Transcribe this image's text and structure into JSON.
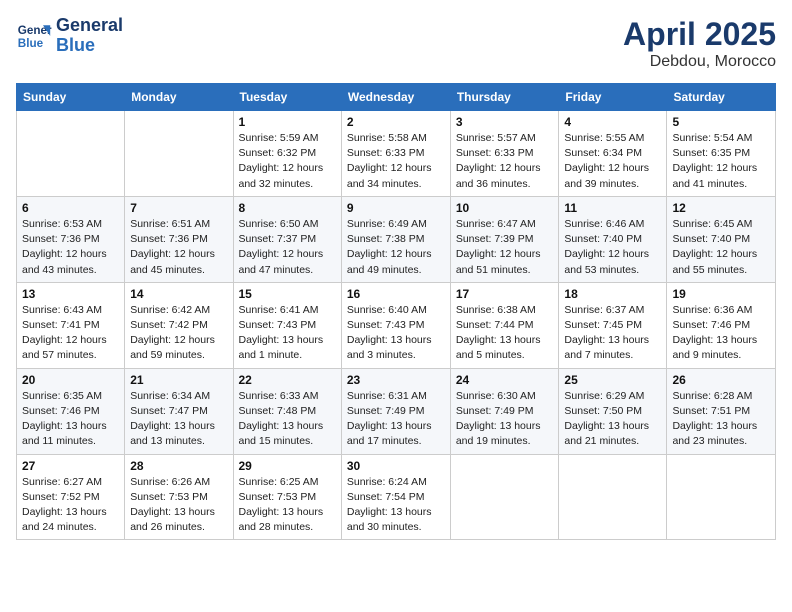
{
  "header": {
    "logo_line1": "General",
    "logo_line2": "Blue",
    "month_title": "April 2025",
    "location": "Debdou, Morocco"
  },
  "days_of_week": [
    "Sunday",
    "Monday",
    "Tuesday",
    "Wednesday",
    "Thursday",
    "Friday",
    "Saturday"
  ],
  "weeks": [
    [
      {
        "day": "",
        "info": ""
      },
      {
        "day": "",
        "info": ""
      },
      {
        "day": "1",
        "info": "Sunrise: 5:59 AM\nSunset: 6:32 PM\nDaylight: 12 hours\nand 32 minutes."
      },
      {
        "day": "2",
        "info": "Sunrise: 5:58 AM\nSunset: 6:33 PM\nDaylight: 12 hours\nand 34 minutes."
      },
      {
        "day": "3",
        "info": "Sunrise: 5:57 AM\nSunset: 6:33 PM\nDaylight: 12 hours\nand 36 minutes."
      },
      {
        "day": "4",
        "info": "Sunrise: 5:55 AM\nSunset: 6:34 PM\nDaylight: 12 hours\nand 39 minutes."
      },
      {
        "day": "5",
        "info": "Sunrise: 5:54 AM\nSunset: 6:35 PM\nDaylight: 12 hours\nand 41 minutes."
      }
    ],
    [
      {
        "day": "6",
        "info": "Sunrise: 6:53 AM\nSunset: 7:36 PM\nDaylight: 12 hours\nand 43 minutes."
      },
      {
        "day": "7",
        "info": "Sunrise: 6:51 AM\nSunset: 7:36 PM\nDaylight: 12 hours\nand 45 minutes."
      },
      {
        "day": "8",
        "info": "Sunrise: 6:50 AM\nSunset: 7:37 PM\nDaylight: 12 hours\nand 47 minutes."
      },
      {
        "day": "9",
        "info": "Sunrise: 6:49 AM\nSunset: 7:38 PM\nDaylight: 12 hours\nand 49 minutes."
      },
      {
        "day": "10",
        "info": "Sunrise: 6:47 AM\nSunset: 7:39 PM\nDaylight: 12 hours\nand 51 minutes."
      },
      {
        "day": "11",
        "info": "Sunrise: 6:46 AM\nSunset: 7:40 PM\nDaylight: 12 hours\nand 53 minutes."
      },
      {
        "day": "12",
        "info": "Sunrise: 6:45 AM\nSunset: 7:40 PM\nDaylight: 12 hours\nand 55 minutes."
      }
    ],
    [
      {
        "day": "13",
        "info": "Sunrise: 6:43 AM\nSunset: 7:41 PM\nDaylight: 12 hours\nand 57 minutes."
      },
      {
        "day": "14",
        "info": "Sunrise: 6:42 AM\nSunset: 7:42 PM\nDaylight: 12 hours\nand 59 minutes."
      },
      {
        "day": "15",
        "info": "Sunrise: 6:41 AM\nSunset: 7:43 PM\nDaylight: 13 hours\nand 1 minute."
      },
      {
        "day": "16",
        "info": "Sunrise: 6:40 AM\nSunset: 7:43 PM\nDaylight: 13 hours\nand 3 minutes."
      },
      {
        "day": "17",
        "info": "Sunrise: 6:38 AM\nSunset: 7:44 PM\nDaylight: 13 hours\nand 5 minutes."
      },
      {
        "day": "18",
        "info": "Sunrise: 6:37 AM\nSunset: 7:45 PM\nDaylight: 13 hours\nand 7 minutes."
      },
      {
        "day": "19",
        "info": "Sunrise: 6:36 AM\nSunset: 7:46 PM\nDaylight: 13 hours\nand 9 minutes."
      }
    ],
    [
      {
        "day": "20",
        "info": "Sunrise: 6:35 AM\nSunset: 7:46 PM\nDaylight: 13 hours\nand 11 minutes."
      },
      {
        "day": "21",
        "info": "Sunrise: 6:34 AM\nSunset: 7:47 PM\nDaylight: 13 hours\nand 13 minutes."
      },
      {
        "day": "22",
        "info": "Sunrise: 6:33 AM\nSunset: 7:48 PM\nDaylight: 13 hours\nand 15 minutes."
      },
      {
        "day": "23",
        "info": "Sunrise: 6:31 AM\nSunset: 7:49 PM\nDaylight: 13 hours\nand 17 minutes."
      },
      {
        "day": "24",
        "info": "Sunrise: 6:30 AM\nSunset: 7:49 PM\nDaylight: 13 hours\nand 19 minutes."
      },
      {
        "day": "25",
        "info": "Sunrise: 6:29 AM\nSunset: 7:50 PM\nDaylight: 13 hours\nand 21 minutes."
      },
      {
        "day": "26",
        "info": "Sunrise: 6:28 AM\nSunset: 7:51 PM\nDaylight: 13 hours\nand 23 minutes."
      }
    ],
    [
      {
        "day": "27",
        "info": "Sunrise: 6:27 AM\nSunset: 7:52 PM\nDaylight: 13 hours\nand 24 minutes."
      },
      {
        "day": "28",
        "info": "Sunrise: 6:26 AM\nSunset: 7:53 PM\nDaylight: 13 hours\nand 26 minutes."
      },
      {
        "day": "29",
        "info": "Sunrise: 6:25 AM\nSunset: 7:53 PM\nDaylight: 13 hours\nand 28 minutes."
      },
      {
        "day": "30",
        "info": "Sunrise: 6:24 AM\nSunset: 7:54 PM\nDaylight: 13 hours\nand 30 minutes."
      },
      {
        "day": "",
        "info": ""
      },
      {
        "day": "",
        "info": ""
      },
      {
        "day": "",
        "info": ""
      }
    ]
  ]
}
